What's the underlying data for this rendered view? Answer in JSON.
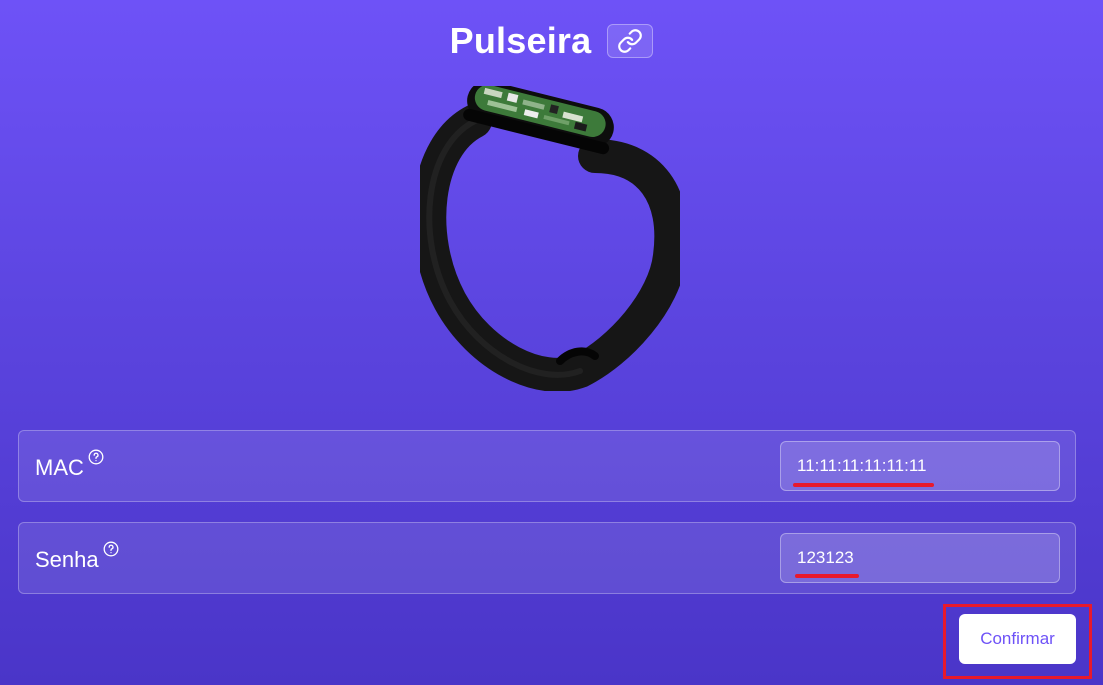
{
  "header": {
    "title": "Pulseira",
    "link_icon": "link-icon"
  },
  "device_image": "smart-bracelet",
  "fields": {
    "mac": {
      "label": "MAC",
      "value": "11:11:11:11:11:11",
      "help_icon": "question-circle-icon"
    },
    "senha": {
      "label": "Senha",
      "value": "123123",
      "help_icon": "question-circle-icon"
    }
  },
  "actions": {
    "confirm_label": "Confirmar"
  },
  "colors": {
    "background_top": "#6e52f7",
    "background_bottom": "#4a35c8",
    "accent_text": "#6e52f7",
    "annotation_red": "#e8192c"
  }
}
